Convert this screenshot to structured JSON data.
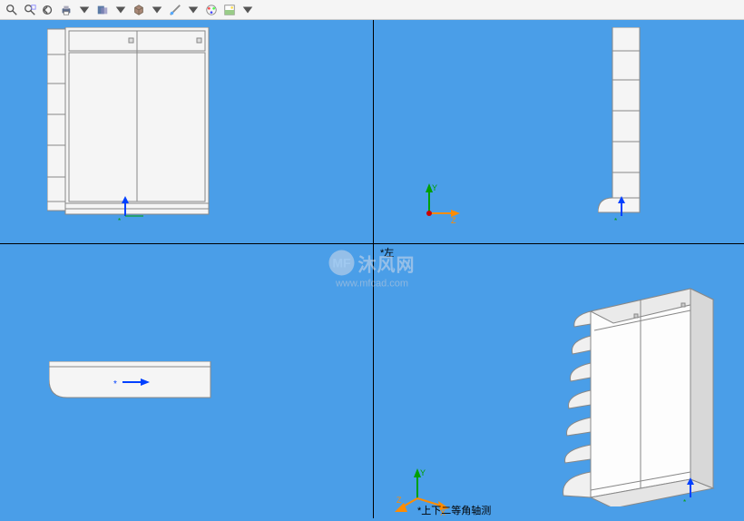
{
  "toolbar": {
    "tools": [
      {
        "name": "zoom-area"
      },
      {
        "name": "zoom-fit"
      },
      {
        "name": "zoom-previous"
      },
      {
        "name": "print"
      },
      {
        "name": "section-view"
      },
      {
        "name": "view-cube"
      },
      {
        "name": "measure"
      },
      {
        "name": "appearance"
      },
      {
        "name": "scene"
      }
    ]
  },
  "panes": {
    "top_left": {
      "view": "front"
    },
    "top_right": {
      "view": "left"
    },
    "bottom_left": {
      "view": "top"
    },
    "bottom_right": {
      "view": "isometric"
    }
  },
  "labels": {
    "left_view": "*左",
    "iso_view": "*上下二等角轴测"
  },
  "watermark": {
    "logo": "MF",
    "brand": "沐风网",
    "url": "www.mfcad.com"
  },
  "axes": {
    "x": "X",
    "y": "Y",
    "z": "Z"
  },
  "colors": {
    "bg": "#4a9ee8",
    "model_fill": "#f5f5f5",
    "model_stroke": "#888888",
    "axis_y": "#00a000",
    "axis_xz": "#ff8c00",
    "axis_blue": "#0040ff"
  }
}
